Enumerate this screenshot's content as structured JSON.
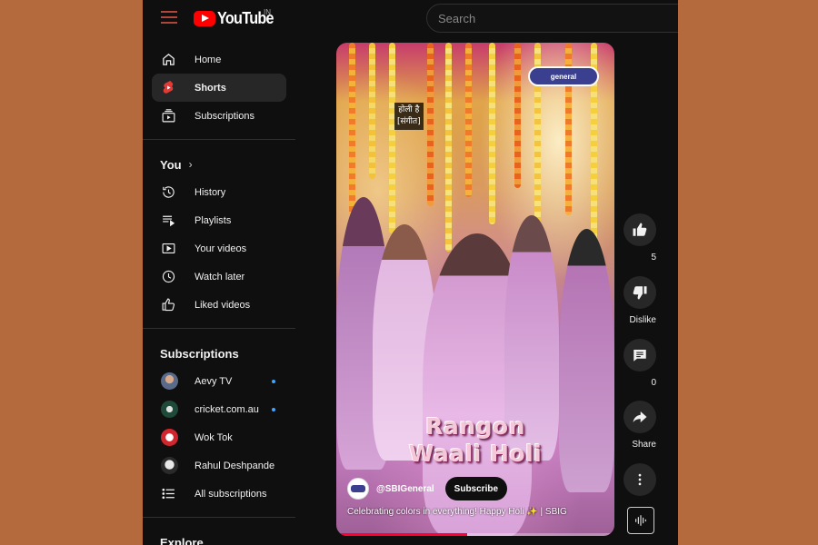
{
  "header": {
    "logo_text": "YouTube",
    "region": "IN",
    "search_placeholder": "Search"
  },
  "sidebar": {
    "main": [
      {
        "label": "Home",
        "icon": "home-icon"
      },
      {
        "label": "Shorts",
        "icon": "shorts-icon",
        "active": true
      },
      {
        "label": "Subscriptions",
        "icon": "subscriptions-icon"
      }
    ],
    "you_title": "You",
    "you_items": [
      {
        "label": "History",
        "icon": "history-icon"
      },
      {
        "label": "Playlists",
        "icon": "playlists-icon"
      },
      {
        "label": "Your videos",
        "icon": "your-videos-icon"
      },
      {
        "label": "Watch later",
        "icon": "watch-later-icon"
      },
      {
        "label": "Liked videos",
        "icon": "liked-videos-icon"
      }
    ],
    "subscriptions_title": "Subscriptions",
    "subscriptions": [
      {
        "label": "Aevy TV",
        "new": true,
        "avatar_color": "#5a6b8a"
      },
      {
        "label": "cricket.com.au",
        "new": true,
        "avatar_color": "#1f4a3a"
      },
      {
        "label": "Wok Tok",
        "new": false,
        "avatar_color": "#d0262e"
      },
      {
        "label": "Rahul Deshpande",
        "new": false,
        "avatar_color": "#3a3a3a"
      },
      {
        "label": "All subscriptions",
        "icon": "list-icon"
      }
    ],
    "explore_title": "Explore"
  },
  "short": {
    "caption_line1": "होली है",
    "caption_line2": "[संगीत]",
    "channel_badge": "general",
    "overlay_line1": "Rangon",
    "overlay_line2": "Waali Holi",
    "channel_name": "@SBIGeneral",
    "subscribe_label": "Subscribe",
    "description": "Celebrating colors in everything! Happy Holi ✨ | SBIG",
    "progress": 0.47
  },
  "actions": {
    "like_count": "5",
    "dislike_label": "Dislike",
    "comment_count": "0",
    "share_label": "Share"
  }
}
